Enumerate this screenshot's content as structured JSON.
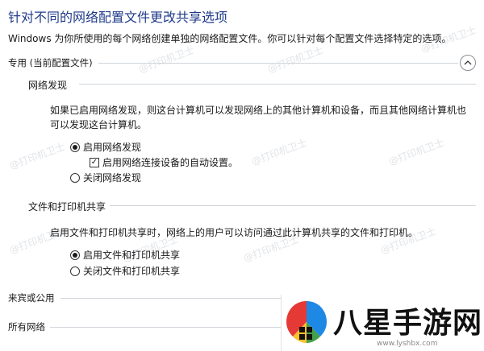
{
  "page": {
    "title": "针对不同的网络配置文件更改共享选项",
    "description": "Windows 为你所使用的每个网络创建单独的网络配置文件。你可以针对每个配置文件选择特定的选项。"
  },
  "private": {
    "header": "专用 (当前配置文件)",
    "collapse_icon": "chevron-up-icon",
    "network_discovery": {
      "title": "网络发现",
      "description": "如果已启用网络发现，则这台计算机可以发现网络上的其他计算机和设备，而且其他网络计算机也可以发现这台计算机。",
      "turn_on": "启用网络发现",
      "auto_setup": "启用网络连接设备的自动设置。",
      "turn_off": "关闭网络发现",
      "selected": "on",
      "auto_setup_checked": true
    },
    "file_printer": {
      "title": "文件和打印机共享",
      "description": "启用文件和打印机共享时，网络上的用户可以访问通过此计算机共享的文件和打印机。",
      "turn_on": "启用文件和打印机共享",
      "turn_off": "关闭文件和打印机共享",
      "selected": "on"
    }
  },
  "guest_public": {
    "header": "来宾或公用"
  },
  "all_networks": {
    "header": "所有网络"
  },
  "watermark": {
    "text": "@打印机卫士"
  },
  "logo": {
    "name": "八星手游网",
    "url": "www.lyshbx.com",
    "icon": "windows-color-logo-icon"
  },
  "colors": {
    "title": "#1f3a8a",
    "divider": "#cfd4da"
  }
}
